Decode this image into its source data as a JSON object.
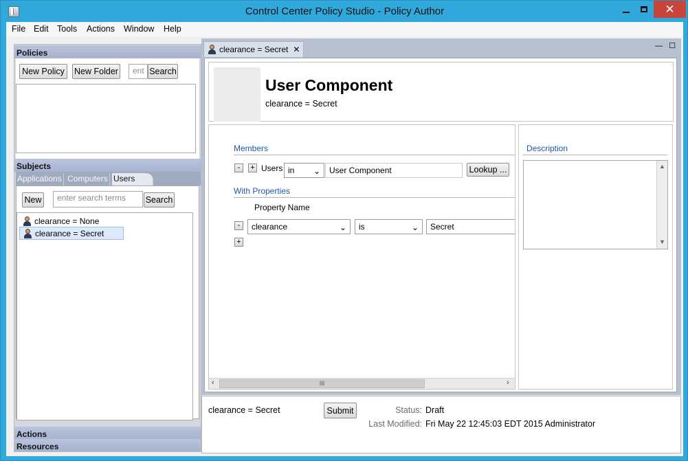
{
  "window": {
    "title": "Control Center Policy Studio - Policy Author",
    "minimize_glyph": "",
    "close_glyph": "✕"
  },
  "menu": [
    "File",
    "Edit",
    "Tools",
    "Actions",
    "Window",
    "Help"
  ],
  "policies": {
    "header": "Policies",
    "new_policy": "New Policy",
    "new_folder": "New Folder",
    "search_value": "ent",
    "search": "Search"
  },
  "subjects": {
    "header": "Subjects",
    "tabs": [
      "Applications",
      "Computers",
      "Users"
    ],
    "active_tab": "Users",
    "new": "New",
    "search_placeholder": "enter search terms",
    "search": "Search",
    "items": [
      "clearance = None",
      "clearance = Secret"
    ],
    "selected_index": 1
  },
  "actions_header": "Actions",
  "resources_header": "Resources",
  "editor": {
    "tab_label": "clearance = Secret",
    "tab_close": "✕",
    "view_min": "—",
    "view_max": "☐",
    "component_title": "User Component",
    "component_subtitle": "clearance = Secret",
    "members_label": "Members",
    "minus": "-",
    "plus": "+",
    "users_label": "Users",
    "in_select": "in",
    "members_value": "User Component",
    "lookup": "Lookup ...",
    "with_properties_label": "With Properties",
    "property_name_header": "Property Name",
    "property_select": "clearance",
    "operator_select": "is",
    "property_value": "Secret",
    "scroll_grip": "III",
    "description_label": "Description"
  },
  "status_panel": {
    "name": "clearance = Secret",
    "submit": "Submit",
    "status_label": "Status:",
    "status_value": "Draft",
    "modified_label": "Last Modified:",
    "modified_value": "Fri May 22 12:45:03 EDT 2015 Administrator"
  },
  "colors": {
    "titlebar": "#31a8dc",
    "section_header": "#b9c4dc",
    "link_blue": "#2057a6",
    "selection": "#dce9fb",
    "close_button": "#c7453a"
  }
}
